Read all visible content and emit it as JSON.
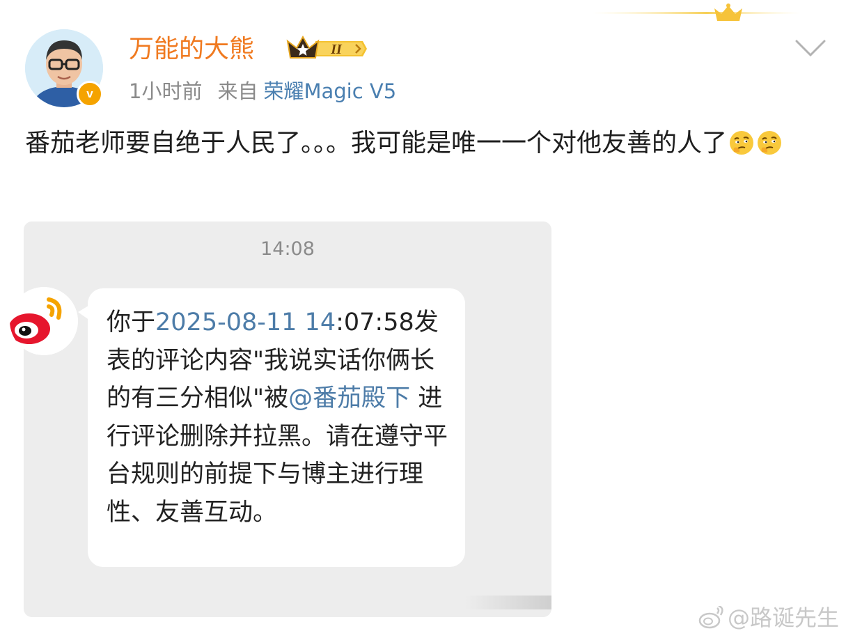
{
  "post": {
    "username": "万能的大熊",
    "level_badge": "II",
    "time_ago": "1小时前",
    "from_label": "来自",
    "device": "荣耀Magic V5",
    "verified_badge": "v",
    "text": "番茄老师要自绝于人民了。。。我可能是唯一一个对他友善的人了",
    "emojis": [
      "thinking-face-emoji",
      "thinking-face-emoji"
    ]
  },
  "screenshot": {
    "time": "14:08",
    "message": {
      "part1": "你于",
      "date": "2025-08-11 14",
      "part2": ":07:58发表的评论内容\"我说实话你俩长的有三分相似\"被",
      "mention": "@番茄殿下",
      "part3": " 进行评论删除并拉黑。请在遵守平台规则的前提下与博主进行理性、友善互动。"
    }
  },
  "watermark": "@路诞先生",
  "colors": {
    "username": "#f07a20",
    "link": "#4a7fb0",
    "chat_bg": "#ededed",
    "badge": "#f5a300"
  }
}
